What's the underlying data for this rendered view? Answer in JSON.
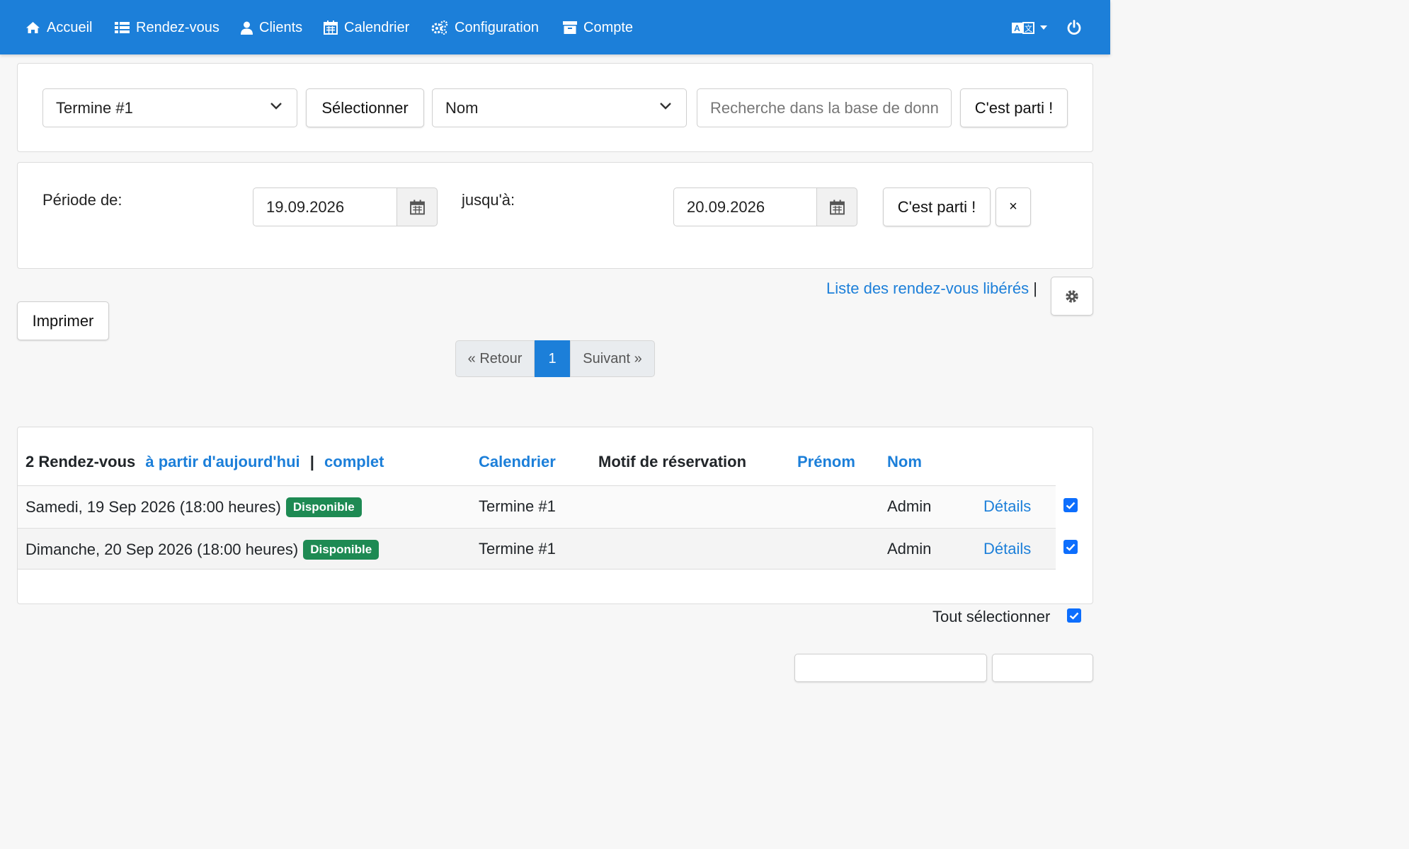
{
  "nav": {
    "items": [
      "Accueil",
      "Rendez-vous",
      "Clients",
      "Calendrier",
      "Configuration",
      "Compte"
    ],
    "language_icon": "translate-icon",
    "power_icon": "power-icon"
  },
  "filter": {
    "calendar_select": "Termine #1",
    "select_button": "Sélectionner",
    "field_select": "Nom",
    "search_placeholder": "Recherche dans la base de donn",
    "go_button": "C'est parti !"
  },
  "period": {
    "from_label": "Période de:",
    "from_date": "19.09.2026",
    "to_label": "jusqu'à:",
    "to_date": "20.09.2026",
    "go_button": "C'est parti !",
    "clear_button": "×"
  },
  "actions": {
    "released_link": "Liste des rendez-vous libérés",
    "separator": "|",
    "print_button": "Imprimer"
  },
  "pagination": {
    "prev": "« Retour",
    "current": "1",
    "next": "Suivant »"
  },
  "table": {
    "count": "2 Rendez-vous",
    "from_today": "à partir d'aujourd'hui",
    "sep": "|",
    "complete": "complet",
    "headers": {
      "calendar": "Calendrier",
      "reason": "Motif de réservation",
      "firstname": "Prénom",
      "lastname": "Nom"
    },
    "rows": [
      {
        "date": "Samedi, 19 Sep 2026 (18:00 heures)",
        "status": "Disponible",
        "calendar": "Termine #1",
        "lastname": "Admin",
        "details": "Détails",
        "checked": true
      },
      {
        "date": "Dimanche, 20 Sep 2026 (18:00 heures)",
        "status": "Disponible",
        "calendar": "Termine #1",
        "lastname": "Admin",
        "details": "Détails",
        "checked": true
      }
    ]
  },
  "select_all": "Tout sélectionner",
  "colors": {
    "primary": "#1c7fd9",
    "badge": "#1e8a53",
    "checkbox": "#0d6efd"
  }
}
